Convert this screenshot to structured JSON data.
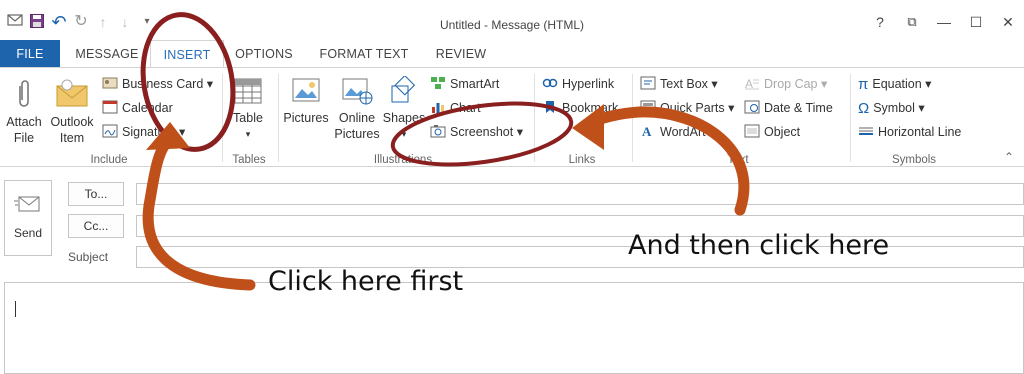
{
  "window": {
    "title": "Untitled - Message (HTML)",
    "help": "?",
    "restore_glyph": "⧉",
    "minimize_glyph": "—",
    "maximize_glyph": "☐",
    "close_glyph": "✕"
  },
  "qat": {
    "undo": "↶",
    "redo": "↻",
    "up": "↑",
    "down": "↓",
    "customize": "▾"
  },
  "tabs": [
    "FILE",
    "MESSAGE",
    "INSERT",
    "OPTIONS",
    "FORMAT TEXT",
    "REVIEW"
  ],
  "ribbon": {
    "include": {
      "attach_file": [
        "Attach",
        "File"
      ],
      "outlook_item": [
        "Outlook",
        "Item"
      ],
      "business_card": "Business Card ▾",
      "calendar": "Calendar",
      "signature": "Signature ▾",
      "group": "Include"
    },
    "tables": {
      "table": "Table",
      "table_arrow": "▾",
      "group": "Tables"
    },
    "illustrations": {
      "pictures": "Pictures",
      "online_pictures": [
        "Online",
        "Pictures"
      ],
      "shapes": "Shapes",
      "shapes_arrow": "▾",
      "smartart": "SmartArt",
      "chart": "Chart",
      "screenshot": "Screenshot ▾",
      "group": "Illustrations"
    },
    "links": {
      "hyperlink": "Hyperlink",
      "bookmark": "Bookmark",
      "group": "Links"
    },
    "text": {
      "text_box": "Text Box ▾",
      "quick_parts": "Quick Parts ▾",
      "wordart": "WordArt ▾",
      "drop_cap": "Drop Cap ▾",
      "date_time": "Date & Time",
      "object": "Object",
      "group": "Text"
    },
    "symbols": {
      "equation": "Equation ▾",
      "symbol": "Symbol ▾",
      "horizontal_line": "Horizontal Line",
      "group": "Symbols",
      "collapse": "⌃"
    }
  },
  "compose": {
    "send": "Send",
    "to": "To...",
    "cc": "Cc...",
    "subject": "Subject",
    "to_value": "",
    "cc_value": "",
    "subject_value": ""
  },
  "annotations": {
    "first": "Click here first",
    "then": "And then click here",
    "color": "#c0501a",
    "circle_color": "#8a1f1f"
  },
  "colors": {
    "file_tab": "#1e64ad",
    "active_tab_text": "#2a6fb9"
  }
}
